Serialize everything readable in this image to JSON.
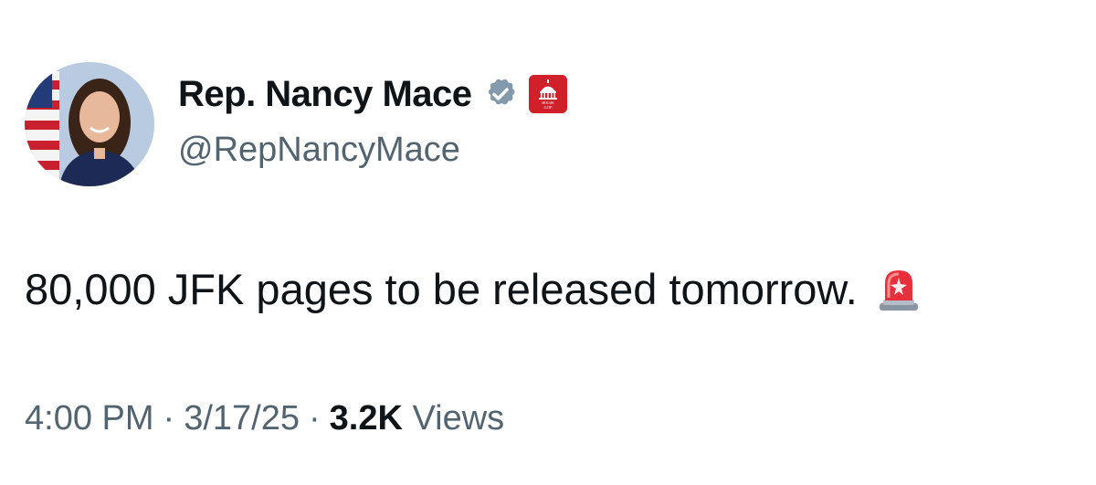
{
  "author": {
    "display_name": "Rep. Nancy Mace",
    "handle": "@RepNancyMace",
    "avatar_icon": "profile-photo",
    "verified_icon": "verified-badge-icon",
    "affiliation_icon": "house-gop-capitol-icon",
    "affiliation_badge_text": [
      "HOUSE",
      "GOP"
    ]
  },
  "tweet": {
    "text": "80,000 JFK pages to be released tomorrow.",
    "emoji_icon": "police-siren-icon"
  },
  "meta": {
    "time": "4:00 PM",
    "separator": "·",
    "date": "3/17/25",
    "views_count": "3.2K",
    "views_label": "Views"
  },
  "colors": {
    "text_primary": "#0f1419",
    "text_secondary": "#536471",
    "verified_gray": "#829aab",
    "badge_red": "#d0202a"
  }
}
